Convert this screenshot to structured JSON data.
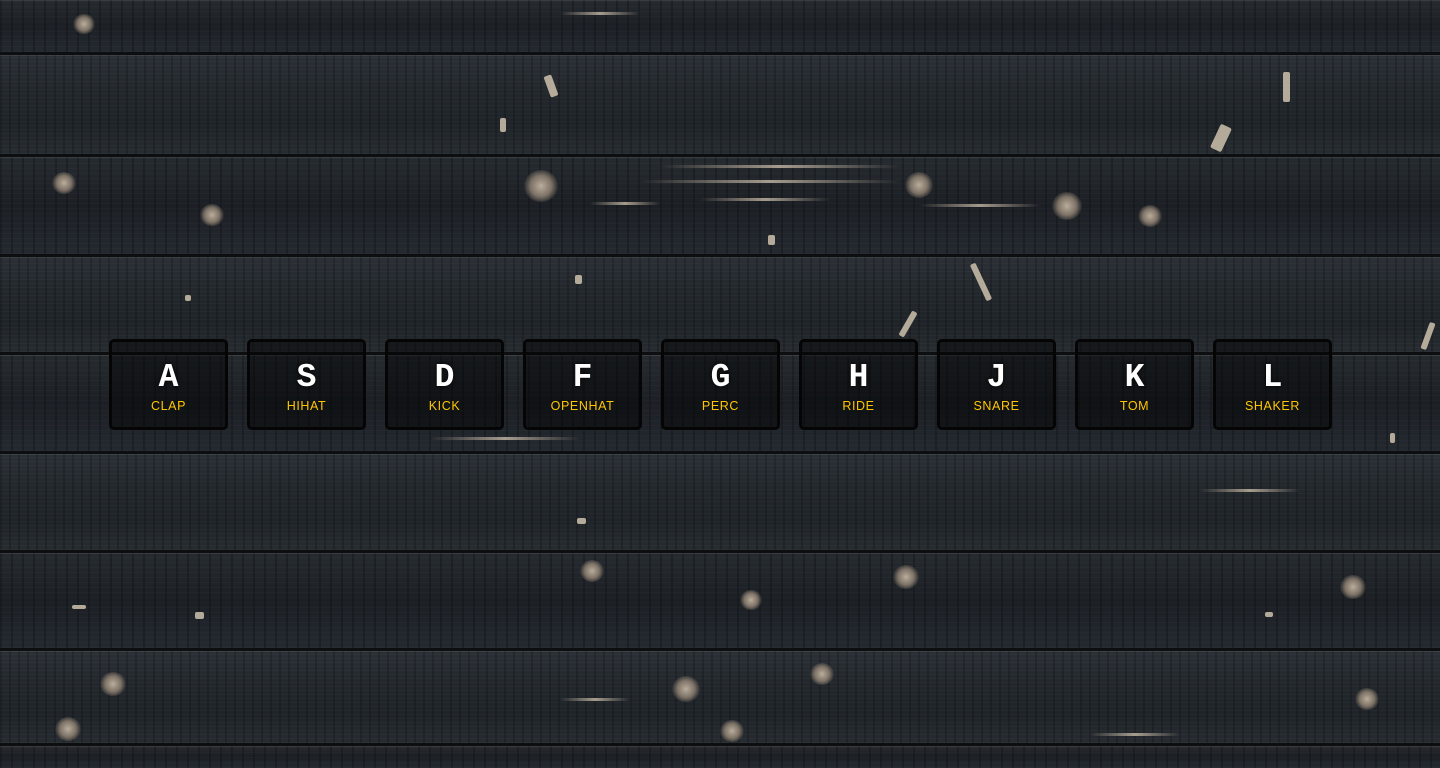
{
  "theme": {
    "accent": "#ffc600",
    "key_text": "#ffffff",
    "background": "burnt-wood-planks"
  },
  "drum_kit": {
    "keys": [
      {
        "key": "A",
        "sound": "clap"
      },
      {
        "key": "S",
        "sound": "hihat"
      },
      {
        "key": "D",
        "sound": "kick"
      },
      {
        "key": "F",
        "sound": "openhat"
      },
      {
        "key": "G",
        "sound": "perc"
      },
      {
        "key": "H",
        "sound": "ride"
      },
      {
        "key": "J",
        "sound": "snare"
      },
      {
        "key": "K",
        "sound": "tom"
      },
      {
        "key": "L",
        "sound": "shaker"
      }
    ]
  }
}
